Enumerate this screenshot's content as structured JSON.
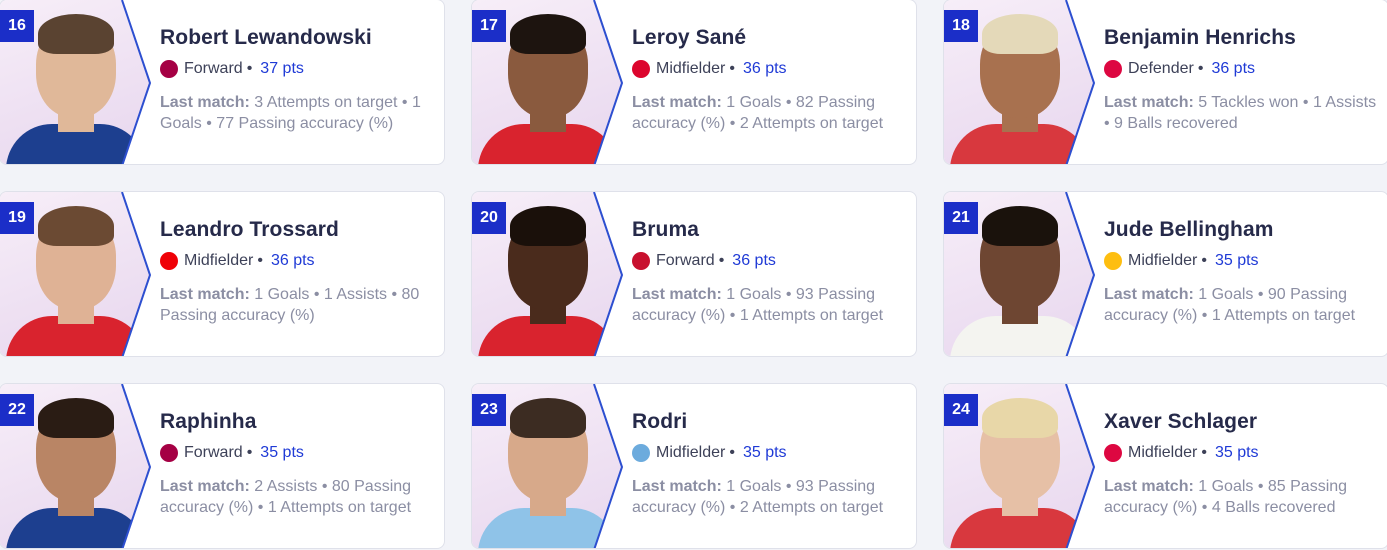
{
  "cards": [
    {
      "rank": "16",
      "name": "Robert Lewandowski",
      "position": "Forward",
      "points": "37 pts",
      "last_label": "Last match:",
      "last_text": "3 Attempts on target • 1 Goals • 77 Passing accuracy (%)",
      "club": "barcelona-crest-icon",
      "club_color": "#a50044",
      "shirt_color": "#1d3f8f",
      "skin": "#e0b899",
      "hair": "#5a4331"
    },
    {
      "rank": "17",
      "name": "Leroy Sané",
      "position": "Midfielder",
      "points": "36 pts",
      "last_label": "Last match:",
      "last_text": "1 Goals • 82 Passing accuracy (%) • 2 Attempts on target",
      "club": "bayern-crest-icon",
      "club_color": "#dc052d",
      "shirt_color": "#d9232e",
      "skin": "#8a5a3e",
      "hair": "#1d140f"
    },
    {
      "rank": "18",
      "name": "Benjamin Henrichs",
      "position": "Defender",
      "points": "36 pts",
      "last_label": "Last match:",
      "last_text": "5 Tackles won • 1 Assists • 9 Balls recovered",
      "club": "leipzig-crest-icon",
      "club_color": "#dd0741",
      "shirt_color": "#d8383e",
      "skin": "#a8714f",
      "hair": "#e4d9b9"
    },
    {
      "rank": "19",
      "name": "Leandro Trossard",
      "position": "Midfielder",
      "points": "36 pts",
      "last_label": "Last match:",
      "last_text": "1 Goals • 1 Assists • 80 Passing accuracy (%)",
      "club": "arsenal-crest-icon",
      "club_color": "#ef0107",
      "shirt_color": "#d9232e",
      "skin": "#dfb295",
      "hair": "#6b4a33"
    },
    {
      "rank": "20",
      "name": "Bruma",
      "position": "Forward",
      "points": "36 pts",
      "last_label": "Last match:",
      "last_text": "1 Goals • 93 Passing accuracy (%) • 1 Attempts on target",
      "club": "braga-crest-icon",
      "club_color": "#c8102e",
      "shirt_color": "#d9232e",
      "skin": "#4a2b1c",
      "hair": "#1a100a"
    },
    {
      "rank": "21",
      "name": "Jude Bellingham",
      "position": "Midfielder",
      "points": "35 pts",
      "last_label": "Last match:",
      "last_text": "1 Goals • 90 Passing accuracy (%) • 1 Attempts on target",
      "club": "real-madrid-crest-icon",
      "club_color": "#febe10",
      "shirt_color": "#f4f4f0",
      "skin": "#6e4632",
      "hair": "#1a120c"
    },
    {
      "rank": "22",
      "name": "Raphinha",
      "position": "Forward",
      "points": "35 pts",
      "last_label": "Last match:",
      "last_text": "2 Assists • 80 Passing accuracy (%) • 1 Attempts on target",
      "club": "barcelona-crest-icon",
      "club_color": "#a50044",
      "shirt_color": "#1d3f8f",
      "skin": "#b98565",
      "hair": "#2a1c14"
    },
    {
      "rank": "23",
      "name": "Rodri",
      "position": "Midfielder",
      "points": "35 pts",
      "last_label": "Last match:",
      "last_text": "1 Goals • 93 Passing accuracy (%) • 2 Attempts on target",
      "club": "man-city-crest-icon",
      "club_color": "#6cabdd",
      "shirt_color": "#8fc3e8",
      "skin": "#d7a98a",
      "hair": "#3c2c22"
    },
    {
      "rank": "24",
      "name": "Xaver Schlager",
      "position": "Midfielder",
      "points": "35 pts",
      "last_label": "Last match:",
      "last_text": "1 Goals • 85 Passing accuracy (%) • 4 Balls recovered",
      "club": "leipzig-crest-icon",
      "club_color": "#dd0741",
      "shirt_color": "#d8383e",
      "skin": "#e6c0a6",
      "hair": "#e8d7a8"
    }
  ],
  "separator": "•"
}
